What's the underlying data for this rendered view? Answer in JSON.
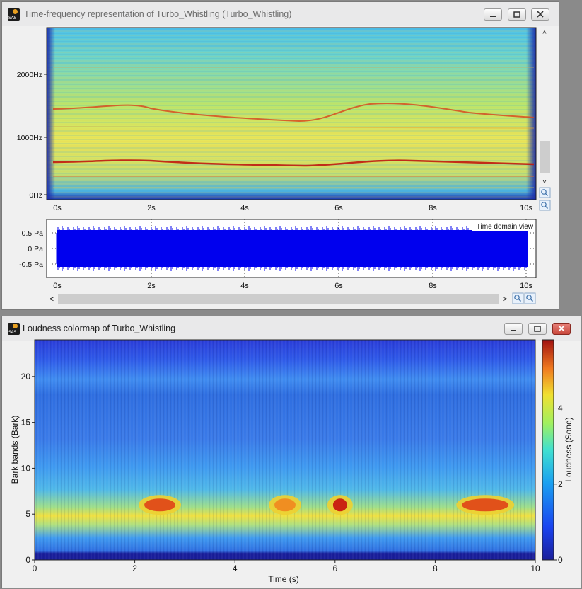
{
  "window1": {
    "title": "Time-frequency representation of Turbo_Whistling (Turbo_Whistling)",
    "spectrogram": {
      "y_ticks": [
        "2000Hz",
        "1000Hz",
        "0Hz"
      ],
      "x_ticks": [
        "0s",
        "2s",
        "4s",
        "6s",
        "8s",
        "10s"
      ]
    },
    "time_domain": {
      "label": "Time domain view",
      "y_ticks": [
        "0.5 Pa",
        "0 Pa",
        "-0.5 Pa"
      ],
      "x_ticks": [
        "0s",
        "2s",
        "4s",
        "6s",
        "8s",
        "10s"
      ]
    },
    "buttons": {
      "minimize": "minimize",
      "maximize": "maximize",
      "close": "close"
    },
    "scroll_arrows": {
      "up": "^",
      "down": "v",
      "left": "<",
      "right": ">"
    }
  },
  "window2": {
    "title": "Loudness colormap of Turbo_Whistling",
    "chart_data": {
      "type": "heatmap",
      "xlabel": "Time (s)",
      "ylabel": "Bark bands (Bark)",
      "colorbar_label": "Loudness (Sone)",
      "x_ticks": [
        "0",
        "2",
        "4",
        "6",
        "8",
        "10"
      ],
      "y_ticks": [
        "20",
        "15",
        "10",
        "5",
        "0"
      ],
      "colorbar_ticks": [
        "4",
        "2",
        "0"
      ],
      "xlim": [
        0,
        10
      ],
      "ylim": [
        0,
        24
      ],
      "clim": [
        0,
        5.8
      ],
      "colormap": "jet",
      "hotspots": [
        {
          "time": 2.5,
          "bark": 6,
          "loudness": 5.2
        },
        {
          "time": 5.0,
          "bark": 6,
          "loudness": 4.5
        },
        {
          "time": 6.1,
          "bark": 6,
          "loudness": 5.6
        },
        {
          "time": 9.0,
          "bark": 6,
          "loudness": 5.0
        }
      ]
    }
  },
  "colors": {
    "waveform": "#0000ee",
    "window_bg": "#f0f0f0",
    "desktop": "#8a8a8a"
  }
}
